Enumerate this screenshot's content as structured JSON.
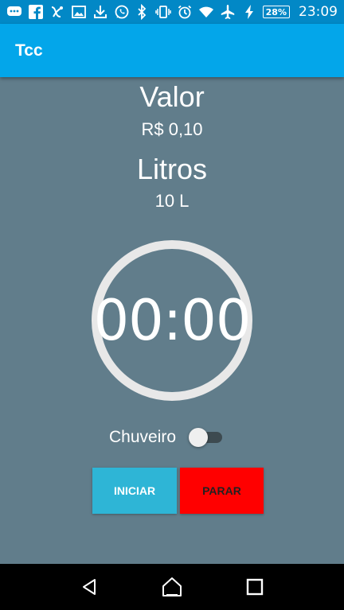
{
  "status_bar": {
    "battery": "28%",
    "time": "23:09",
    "icons_left": [
      "chat-icon",
      "facebook-icon",
      "xcode-icon",
      "image-icon",
      "download-icon",
      "whatsapp-icon"
    ],
    "icons_right": [
      "bluetooth-icon",
      "vibrate-icon",
      "alarm-icon",
      "wifi-icon",
      "airplane-icon",
      "charging-icon",
      "battery-icon"
    ]
  },
  "app_bar": {
    "title": "Tcc"
  },
  "main": {
    "valor_label": "Valor",
    "valor_value": "R$ 0,10",
    "litros_label": "Litros",
    "litros_value": "10 L",
    "timer": "00:00",
    "switch_label": "Chuveiro",
    "switch_on": false,
    "start_button": "INICIAR",
    "stop_button": "PARAR"
  },
  "colors": {
    "status_bar": "#0288c6",
    "app_bar": "#03a6ea",
    "background": "#617d8b",
    "start_button": "#2eb5d6",
    "stop_button": "#ff0000"
  },
  "nav_bar": {
    "icons": [
      "back-icon",
      "home-icon",
      "recents-icon"
    ]
  }
}
